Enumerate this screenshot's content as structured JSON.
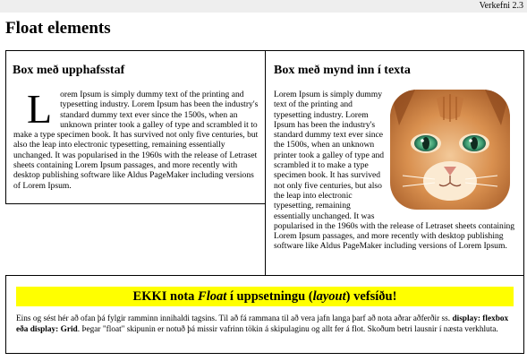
{
  "header": {
    "assignment": "Verkefni 2.3",
    "title": "Float elements"
  },
  "box1": {
    "heading": "Box með upphafsstaf",
    "dropcap": "L",
    "text": "orem Ipsum is simply dummy text of the printing and typesetting industry. Lorem Ipsum has been the industry's standard dummy text ever since the 1500s, when an unknown printer took a galley of type and scrambled it to make a type specimen book. It has survived not only five centuries, but also the leap into electronic typesetting, remaining essentially unchanged. It was popularised in the 1960s with the release of Letraset sheets containing Lorem Ipsum passages, and more recently with desktop publishing software like Aldus PageMaker including versions of Lorem Ipsum."
  },
  "box2": {
    "heading": "Box með mynd inn í texta",
    "image": "cat-photo",
    "text": "Lorem Ipsum is simply dummy text of the printing and typesetting industry. Lorem Ipsum has been the industry's standard dummy text ever since the 1500s, when an unknown printer took a galley of type and scrambled it to make a type specimen book. It has survived not only five centuries, but also the leap into electronic typesetting, remaining essentially unchanged. It was popularised in the 1960s with the release of Letraset sheets containing Lorem Ipsum passages, and more recently with desktop publishing software like Aldus PageMaker including versions of Lorem Ipsum."
  },
  "box3": {
    "banner_pre": "EKKI nota ",
    "banner_float": "Float",
    "banner_mid": " í uppsetningu (",
    "banner_layout": "layout",
    "banner_post": ") vefsíðu!",
    "note_pre": "Eins og sést hér að ofan þá fylgir ramminn innihaldi tagsins. Til að fá rammana til að vera jafn langa þarf að nota aðrar aðferðir ss. ",
    "note_bold": "display: flexbox eða display: Grid",
    "note_post": ". Þegar \"float\" skipunin er notuð þá missir vafrinn tökin á skipulaginu og allt fer á flot. Skoðum betri lausnir í næsta verkhluta."
  },
  "colors": {
    "banner": "#ffff00",
    "topbar": "#eeeeee"
  }
}
